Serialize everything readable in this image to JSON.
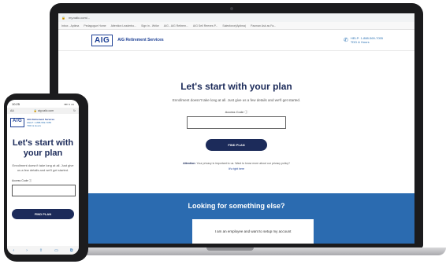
{
  "laptop": {
    "browser": {
      "url": "my.valic.com/...",
      "bookmarks": [
        "Inbox - Aptima",
        "Pedagogue Home",
        "Attention Leaderbo...",
        "Sign in - Wrike",
        "AIG - AIG Retirem...",
        "AIG Sell Reeves P...",
        "Salesforce(Aptima)",
        "Pacman Ask as Fa..."
      ]
    },
    "header": {
      "logo": "AIG",
      "brand": "AIG Retirement Services",
      "contact_line1": "HELP: 1-888-569-7055",
      "contact_line2": "TDD & Hours"
    },
    "main": {
      "heading": "Let's start with your plan",
      "subtext": "Enrollment doesn't take long at all. Just give us a few details and we'll get started.",
      "access_label": "Access Code ⓘ",
      "button": "FIND PLAN",
      "attention_bold": "Attention:",
      "attention_text": "Your privacy is important to us. Want to know more about our privacy policy?",
      "right_here": "It's right here"
    },
    "band": {
      "title": "Looking for something else?",
      "card": "I am an employee and want to setup my account"
    }
  },
  "phone": {
    "status": {
      "time": "10:25",
      "signal": "▪▪▪ ≈ ▭"
    },
    "url_left": "AA",
    "url": "🔒 aig.valic.com",
    "url_right": "↻",
    "header": {
      "logo": "AIG",
      "brand": "AIG Retirement Services",
      "contact_line1": "HELP: 1-888-569-7055",
      "contact_line2": "TDD & Hours"
    },
    "heading": "Let's start with your plan",
    "subtext": "Enrollment doesn't take long at all. Just give us a few details and we'll get started.",
    "access_label": "Access Code ⓘ",
    "button": "FIND PLAN",
    "nav": [
      "‹",
      "›",
      "⇪",
      "▭",
      "⧉"
    ]
  }
}
